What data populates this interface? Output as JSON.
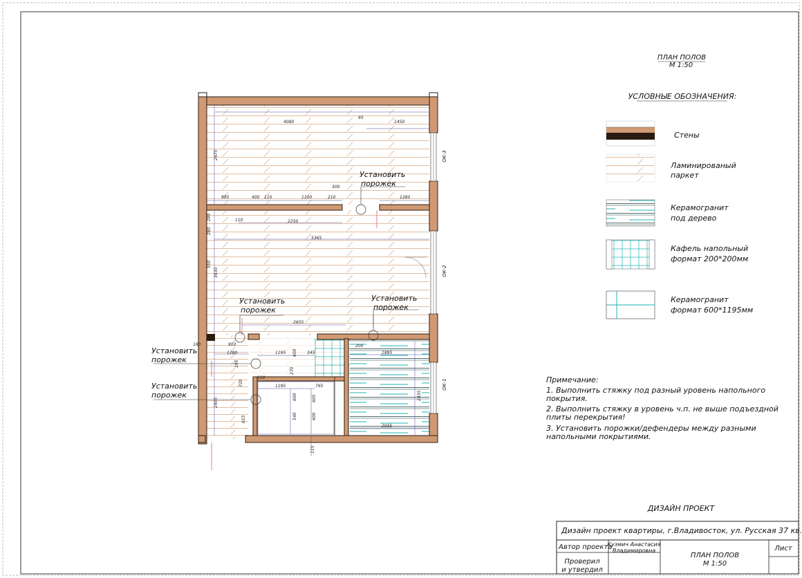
{
  "sheet": {
    "title": "ПЛАН ПОЛОВ",
    "scale": "М 1:50",
    "legend_title": "УСЛОВНЫЕ ОБОЗНАЧЕНИЯ:",
    "colors": {
      "wall": "#cf9a73",
      "wall_edge": "#2a1a10",
      "laminate": "#d7a57f",
      "tile": "#1fb3b3",
      "red_dim": "#e05a6a",
      "dim_line": "#4a4a9a"
    }
  },
  "legend": [
    {
      "label": "Стены",
      "icon": "wall-swatch"
    },
    {
      "label_1": "Ламинированый",
      "label_2": "паркет",
      "icon": "laminate-swatch"
    },
    {
      "label_1": "Керамогранит",
      "label_2": "под дерево",
      "icon": "wood-tile-swatch"
    },
    {
      "label_1": "Кафель напольный",
      "label_2": "формат 200*200мм",
      "icon": "small-tile-swatch"
    },
    {
      "label_1": "Керамогранит",
      "label_2": "формат 600*1195мм",
      "icon": "large-tile-swatch"
    }
  ],
  "notes": {
    "heading": "Примечание:",
    "lines": [
      "1. Выполнить стяжку под разный уровень напольного",
      "покрытия.",
      "2. Выполнить стяжку в уровень ч.п. не выше подъездной",
      "плиты перекрытия!",
      "3. Установить порожки/дефендеры между разными",
      "напольными покрытиями."
    ]
  },
  "plan": {
    "threshold_line1": "Установить",
    "threshold_line2": "порожек",
    "windows": [
      "ОК-3",
      "ОК-2",
      "ОК-1"
    ],
    "dimensions": [
      "4080",
      "1450",
      "95",
      "2475",
      "995",
      "400",
      "110",
      "1100",
      "300",
      "210",
      "1280",
      "110",
      "2250",
      "5365",
      "3830",
      "2655",
      "160",
      "910",
      "1280",
      "1195",
      "600",
      "345",
      "195",
      "1895",
      "2455",
      "110",
      "1195",
      "765",
      "2435",
      "540",
      "600",
      "605",
      "600",
      "2035",
      "115",
      "270",
      "295",
      "280",
      "550",
      "720",
      "615",
      "200"
    ]
  },
  "title_block": {
    "design_heading": "ДИЗАЙН ПРОЕКТ",
    "project_line": "Дизайн проект квартиры, г.Владивосток, ул. Русская 37 кв.",
    "author_label": "Автор проекта",
    "author_name_1": "Кузмич Анастасия",
    "author_name_2": "Владимировна",
    "checked_label_1": "Проверил",
    "checked_label_2": "и утвердил",
    "sheet_title": "ПЛАН ПОЛОВ",
    "sheet_scale": "М 1:50",
    "sheet_label": "Лист"
  }
}
